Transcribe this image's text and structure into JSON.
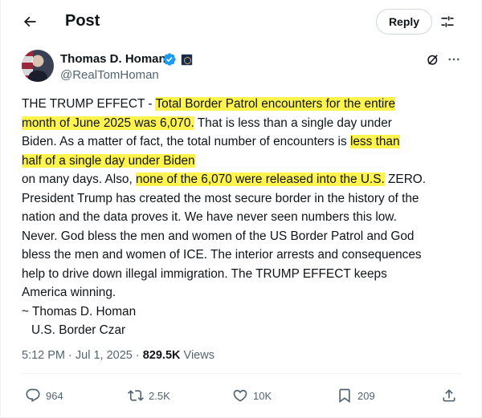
{
  "header": {
    "title": "Post",
    "reply_label": "Reply",
    "back_icon": "arrow-left-icon",
    "filter_icon": "sliders-icon"
  },
  "author": {
    "name": "Thomas D. Homan",
    "handle": "@RealTomHoman",
    "verified_color": "#1d9bf0"
  },
  "tweet": {
    "lines": [
      {
        "parts": [
          {
            "t": "THE TRUMP EFFECT - "
          },
          {
            "t": "Total Border Patrol encounters for the entire",
            "hl": true
          }
        ]
      },
      {
        "parts": [
          {
            "t": "month of June 2025 was 6,070.",
            "hl": true
          },
          {
            "t": "  That is less than a single day under"
          }
        ]
      },
      {
        "parts": [
          {
            "t": "Biden. As a matter of fact, the total number of encounters is "
          },
          {
            "t": "less than",
            "hl": true
          }
        ]
      },
      {
        "parts": [
          {
            "t": "half of a single day under Biden",
            "hl": true
          }
        ]
      },
      {
        "parts": [
          {
            "t": "on many days. Also, "
          },
          {
            "t": "none of the 6,070 were released into the U.S.",
            "hl": true
          },
          {
            "t": " ZERO."
          }
        ]
      },
      {
        "parts": [
          {
            "t": "President Trump has created the most secure border in the history of the"
          }
        ]
      },
      {
        "parts": [
          {
            "t": "nation and the data proves it.  We have never seen numbers this low."
          }
        ]
      },
      {
        "parts": [
          {
            "t": "Never. God bless the men and women of the US Border Patrol and God"
          }
        ]
      },
      {
        "parts": [
          {
            "t": "bless the men and women of ICE.  The interior arrests and consequences"
          }
        ]
      },
      {
        "parts": [
          {
            "t": "help to drive down illegal immigration.  The TRUMP EFFECT keeps"
          }
        ]
      },
      {
        "parts": [
          {
            "t": "America winning."
          }
        ]
      },
      {
        "parts": [
          {
            "t": "~ Thomas D. Homan"
          }
        ]
      },
      {
        "parts": [
          {
            "t": "U.S. Border Czar"
          }
        ],
        "indent": true
      }
    ],
    "highlight_color": "#fff34d"
  },
  "meta": {
    "time": "5:12 PM",
    "sep": " · ",
    "date": "Jul 1, 2025",
    "views": "829.5K",
    "views_label": " Views"
  },
  "actions": {
    "replies": "964",
    "reposts": "2.5K",
    "likes": "10K",
    "bookmarks": "209"
  }
}
